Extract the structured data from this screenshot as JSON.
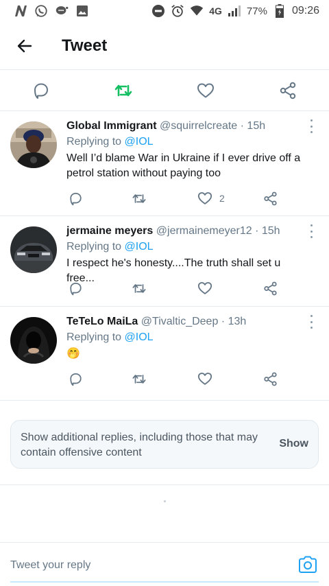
{
  "status_bar": {
    "left_icons": [
      "n-app-icon",
      "whatsapp-icon",
      "chat-bubble-icon",
      "gallery-icon"
    ],
    "right_icons": [
      "do-not-disturb-icon",
      "alarm-icon",
      "wifi-icon",
      "signal-icon",
      "battery-icon"
    ],
    "network": "4G",
    "battery": "77%",
    "time": "09:26"
  },
  "header": {
    "title": "Tweet",
    "back_icon": "arrow-left-icon"
  },
  "action_bar": {
    "icons": [
      "reply-icon",
      "retweet-icon",
      "like-icon",
      "share-icon"
    ],
    "retweet_active_color": "#17bf63"
  },
  "replies": [
    {
      "name": "Global Immigrant",
      "meta": "@squirrelcreate · 15h",
      "replying_prefix": "Replying to ",
      "replying_to": "@IOL",
      "text": "Well I’d blame War in Ukraine if I ever drive off a petrol station without paying too",
      "likes": "2"
    },
    {
      "name": "jermaine meyers",
      "meta": "@jermainemeyer12 · 15h",
      "replying_prefix": "Replying to ",
      "replying_to": "@IOL",
      "text": "I respect he's honesty....The truth shall set u free..."
    },
    {
      "name": "TeTeLo MaiLa",
      "meta": "@Tivaltic_Deep · 13h",
      "replying_prefix": "Replying to ",
      "replying_to": "@IOL",
      "text": "🤭"
    }
  ],
  "more_replies": {
    "text": "Show additional replies, including those that may contain offensive content",
    "button": "Show"
  },
  "composer": {
    "placeholder": "Tweet your reply",
    "camera_icon": "camera-icon"
  },
  "colors": {
    "accent": "#1da1f2",
    "icon_gray": "#657786",
    "divider": "#e6ecf0"
  }
}
